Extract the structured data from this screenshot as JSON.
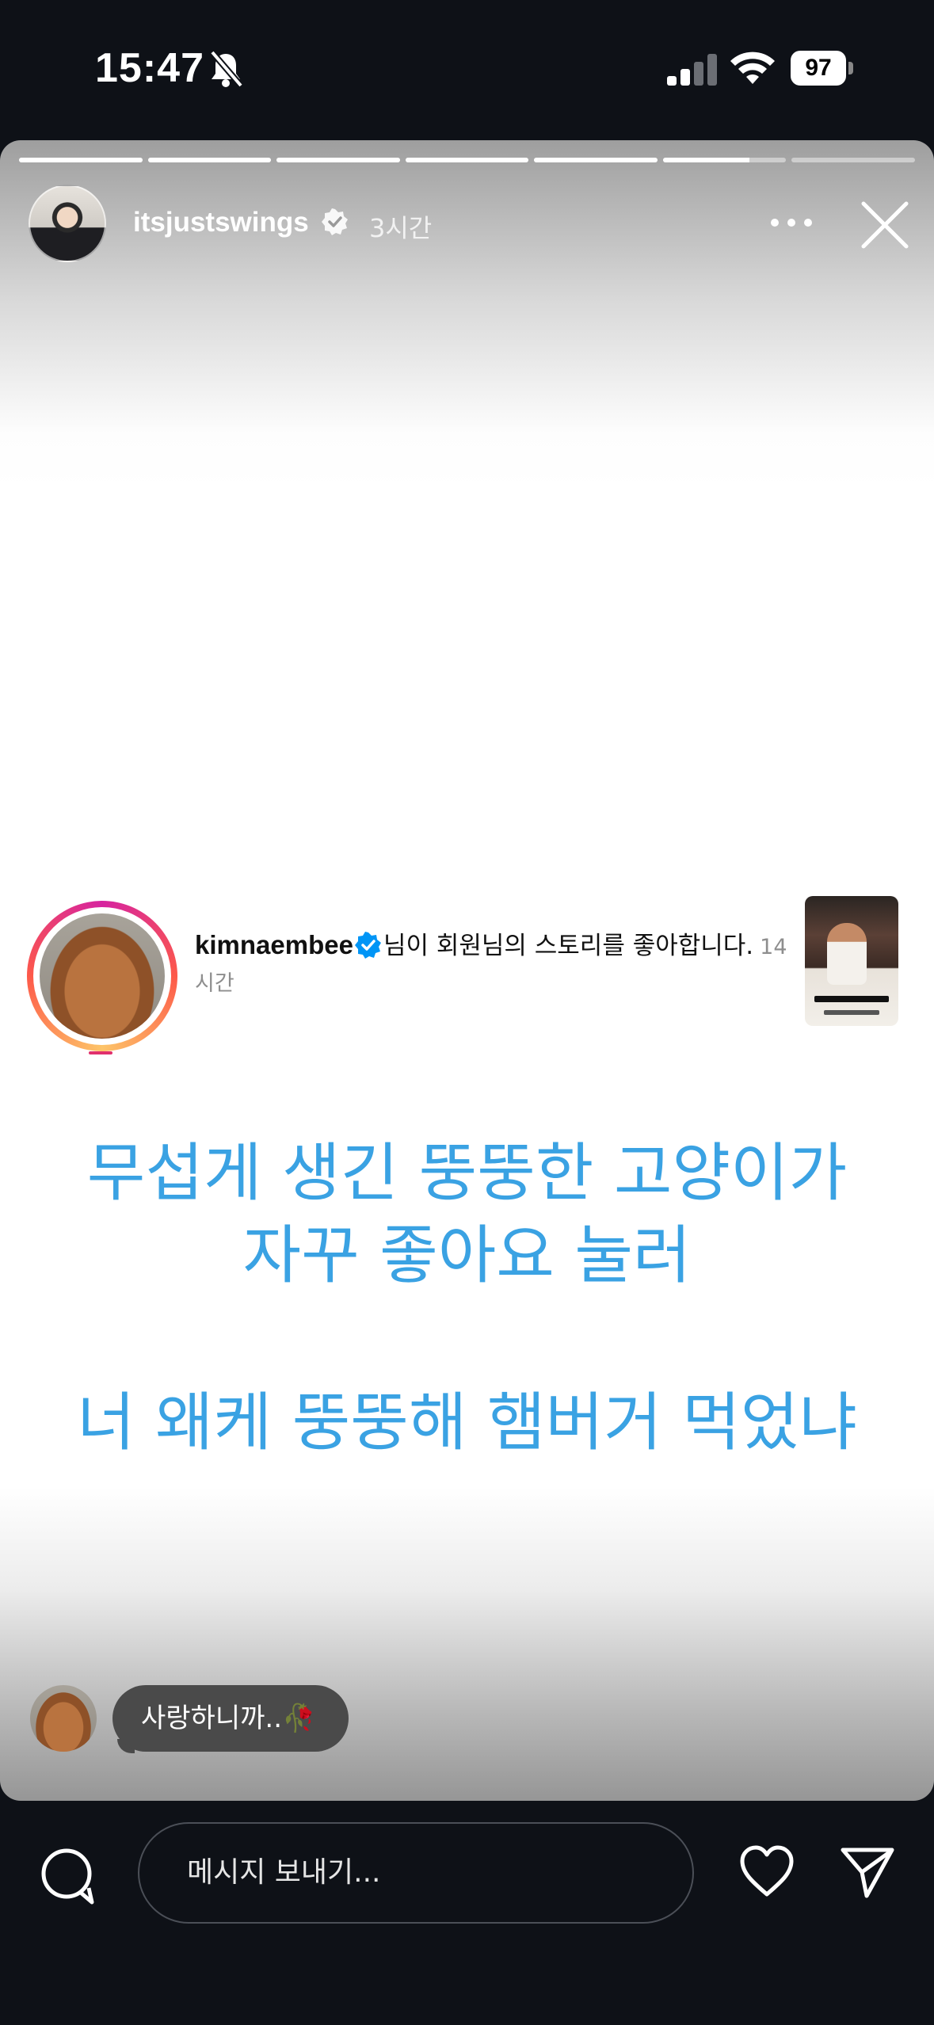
{
  "status_bar": {
    "time": "15:47",
    "battery": "97",
    "icons": [
      "bell-slash-icon",
      "signal-icon",
      "wifi-icon",
      "battery-icon"
    ]
  },
  "story": {
    "segments": 7,
    "progress": [
      1,
      1,
      1,
      1,
      1,
      0.7,
      0
    ],
    "author": "itsjustswings",
    "time": "3시간",
    "icons": [
      "verified-badge-icon",
      "more-options-icon",
      "close-icon"
    ]
  },
  "notification": {
    "username": "kimnaembee",
    "message": "님이 회원님의 스토리를 좋아합니다.",
    "time": "14시간"
  },
  "caption": {
    "line1": "무섭게 생긴 뚱뚱한 고양이가",
    "line2": "자꾸 좋아요 눌러",
    "line3": "너 왜케 뚱뚱해 햄버거 먹었냐"
  },
  "reply": {
    "text": "사랑하니까..🥀"
  },
  "bottom_bar": {
    "placeholder": "메시지 보내기...",
    "icons": [
      "camera-search-icon",
      "heart-icon",
      "send-icon"
    ]
  },
  "colors": {
    "background": "#0e1117",
    "caption_blue": "#3aa2e3",
    "verified_blue": "#0095f6",
    "reply_bubble": "#4a4a4a"
  }
}
